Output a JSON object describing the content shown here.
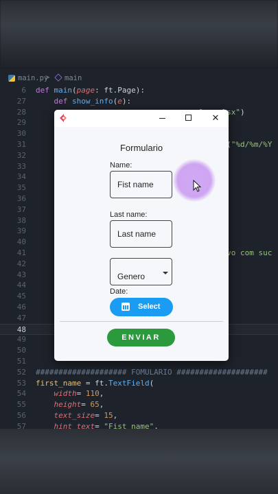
{
  "editor": {
    "tab": {
      "file": "main.py",
      "separator": ">",
      "symbol": "main"
    },
    "lines": [
      {
        "n": "6",
        "html": "<span class=\"kw\">def</span> <span class=\"fn\">main</span>(<span class=\"prp\">page</span>: ft.Page):"
      },
      {
        "n": "27",
        "html": "    <span class=\"kw\">def</span> <span class=\"fn\">show_info</span>(<span class=\"prp\">e</span>):"
      },
      {
        "n": "28",
        "html": "                                    <span class=\"str\">lps.xlsx\"</span>)"
      },
      {
        "n": "29",
        "html": ""
      },
      {
        "n": "30",
        "html": ""
      },
      {
        "n": "31",
        "html": "                                        <span class=\"fn\">me</span>(<span class=\"str\">\"%d/%m/%Y</span>"
      },
      {
        "n": "32",
        "html": ""
      },
      {
        "n": "33",
        "html": ""
      },
      {
        "n": "34",
        "html": ""
      },
      {
        "n": "35",
        "html": ""
      },
      {
        "n": "36",
        "html": ""
      },
      {
        "n": "37",
        "html": ""
      },
      {
        "n": "38",
        "html": ""
      },
      {
        "n": "39",
        "html": ""
      },
      {
        "n": "40",
        "html": ""
      },
      {
        "n": "41",
        "html": "                                        <span class=\"str\">alvo com suc</span>"
      },
      {
        "n": "42",
        "html": ""
      },
      {
        "n": "43",
        "html": ""
      },
      {
        "n": "44",
        "html": ""
      },
      {
        "n": "45",
        "html": ""
      },
      {
        "n": "46",
        "html": ""
      },
      {
        "n": "47",
        "html": ""
      },
      {
        "n": "48",
        "html": "",
        "active": true
      },
      {
        "n": "49",
        "html": ""
      },
      {
        "n": "50",
        "html": ""
      },
      {
        "n": "51",
        "html": ""
      },
      {
        "n": "52",
        "html": "<span class=\"cm\">#################### FOMULARIO ####################</span>"
      },
      {
        "n": "53",
        "html": "<span class=\"prm\">first_name</span> = ft.<span class=\"fn\">TextField</span>("
      },
      {
        "n": "54",
        "html": "    <span class=\"prp\">width</span>= <span class=\"num\">110</span>,"
      },
      {
        "n": "55",
        "html": "    <span class=\"prp\">height</span>= <span class=\"num\">65</span>,"
      },
      {
        "n": "56",
        "html": "    <span class=\"prp\">text_size</span>= <span class=\"num\">15</span>,"
      },
      {
        "n": "57",
        "html": "    <span class=\"prp\">hint_text</span>= <span class=\"str\">\"Fist name\"</span>,"
      }
    ]
  },
  "window": {
    "controls": {
      "minimize": "",
      "maximize": "",
      "close": "✕"
    },
    "form": {
      "title": "Formulario",
      "name_label": "Name:",
      "name_hint": "Fist name",
      "last_name_label": "Last name:",
      "last_name_hint": "Last name",
      "gender_value": "Genero",
      "date_label": "Date:",
      "select_label": "Select",
      "send_label": "ENVIAR"
    }
  },
  "colors": {
    "accent_blue": "#1a9cf2",
    "send_green": "#2a9a3d",
    "cursor_highlight": "#cfa5f5"
  }
}
